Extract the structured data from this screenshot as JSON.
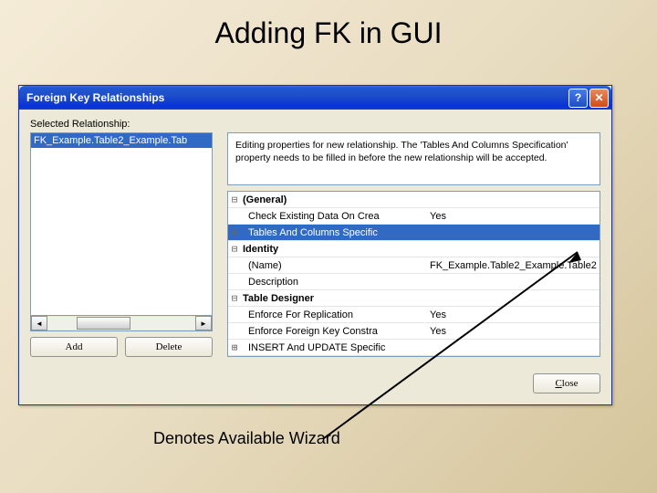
{
  "slide": {
    "title": "Adding FK in GUI",
    "caption": "Denotes Available Wizard"
  },
  "dialog": {
    "title": "Foreign Key Relationships",
    "selected_label": "Selected Relationship:",
    "list_item": "FK_Example.Table2_Example.Tab",
    "info_text": "Editing properties for new relationship. The 'Tables And Columns Specification' property needs to be filled in before the new relationship will be accepted.",
    "add_label": "Add",
    "delete_label": "Delete",
    "close_letter": "C",
    "close_rest": "lose"
  },
  "grid": {
    "rows": [
      {
        "exp": "⊟",
        "label": "(General)",
        "val": "",
        "cat": true
      },
      {
        "exp": "",
        "label": "Check Existing Data On Crea",
        "val": "Yes"
      },
      {
        "exp": "⊞",
        "label": "Tables And Columns Specific",
        "val": "",
        "hl": true,
        "ell": true
      },
      {
        "exp": "⊟",
        "label": "Identity",
        "val": "",
        "cat": true
      },
      {
        "exp": "",
        "label": "(Name)",
        "val": "FK_Example.Table2_Example.Table2"
      },
      {
        "exp": "",
        "label": "Description",
        "val": ""
      },
      {
        "exp": "⊟",
        "label": "Table Designer",
        "val": "",
        "cat": true
      },
      {
        "exp": "",
        "label": "Enforce For Replication",
        "val": "Yes"
      },
      {
        "exp": "",
        "label": "Enforce Foreign Key Constra",
        "val": "Yes"
      },
      {
        "exp": "⊞",
        "label": "INSERT And UPDATE Specific",
        "val": ""
      }
    ]
  }
}
